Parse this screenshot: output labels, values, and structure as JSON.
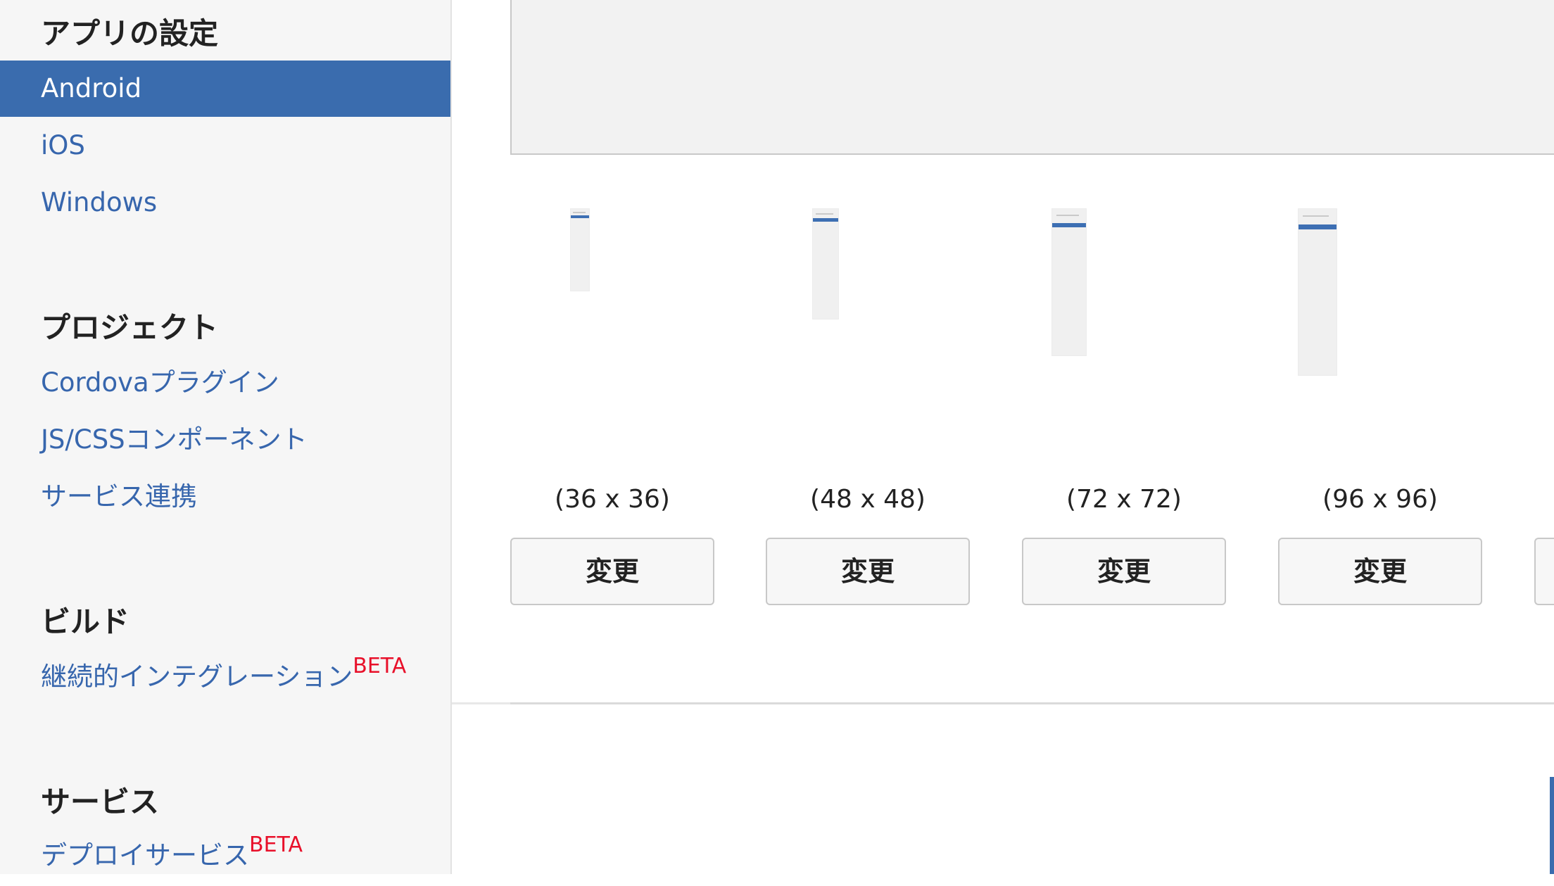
{
  "sidebar": {
    "sections": [
      {
        "title": "アプリの設定",
        "items": [
          {
            "label": "Android",
            "active": true
          },
          {
            "label": "iOS"
          },
          {
            "label": "Windows"
          }
        ]
      },
      {
        "title": "プロジェクト",
        "items": [
          {
            "label": "Cordovaプラグイン"
          },
          {
            "label": "JS/CSSコンポーネント"
          },
          {
            "label": "サービス連携"
          }
        ]
      },
      {
        "title": "ビルド",
        "items": [
          {
            "label": "継続的インテグレーション",
            "badge": "BETA"
          }
        ]
      },
      {
        "title": "サービス",
        "items": [
          {
            "label": "デプロイサービス",
            "badge": "BETA"
          }
        ]
      }
    ]
  },
  "icons": [
    {
      "size_label": "(36 x 36)",
      "button_label": "変更"
    },
    {
      "size_label": "(48 x 48)",
      "button_label": "変更"
    },
    {
      "size_label": "(72 x 72)",
      "button_label": "変更"
    },
    {
      "size_label": "(96 x 96)",
      "button_label": "変更"
    }
  ],
  "colors": {
    "accent": "#3a6cae",
    "link": "#3766ad",
    "beta": "#e8102a"
  }
}
